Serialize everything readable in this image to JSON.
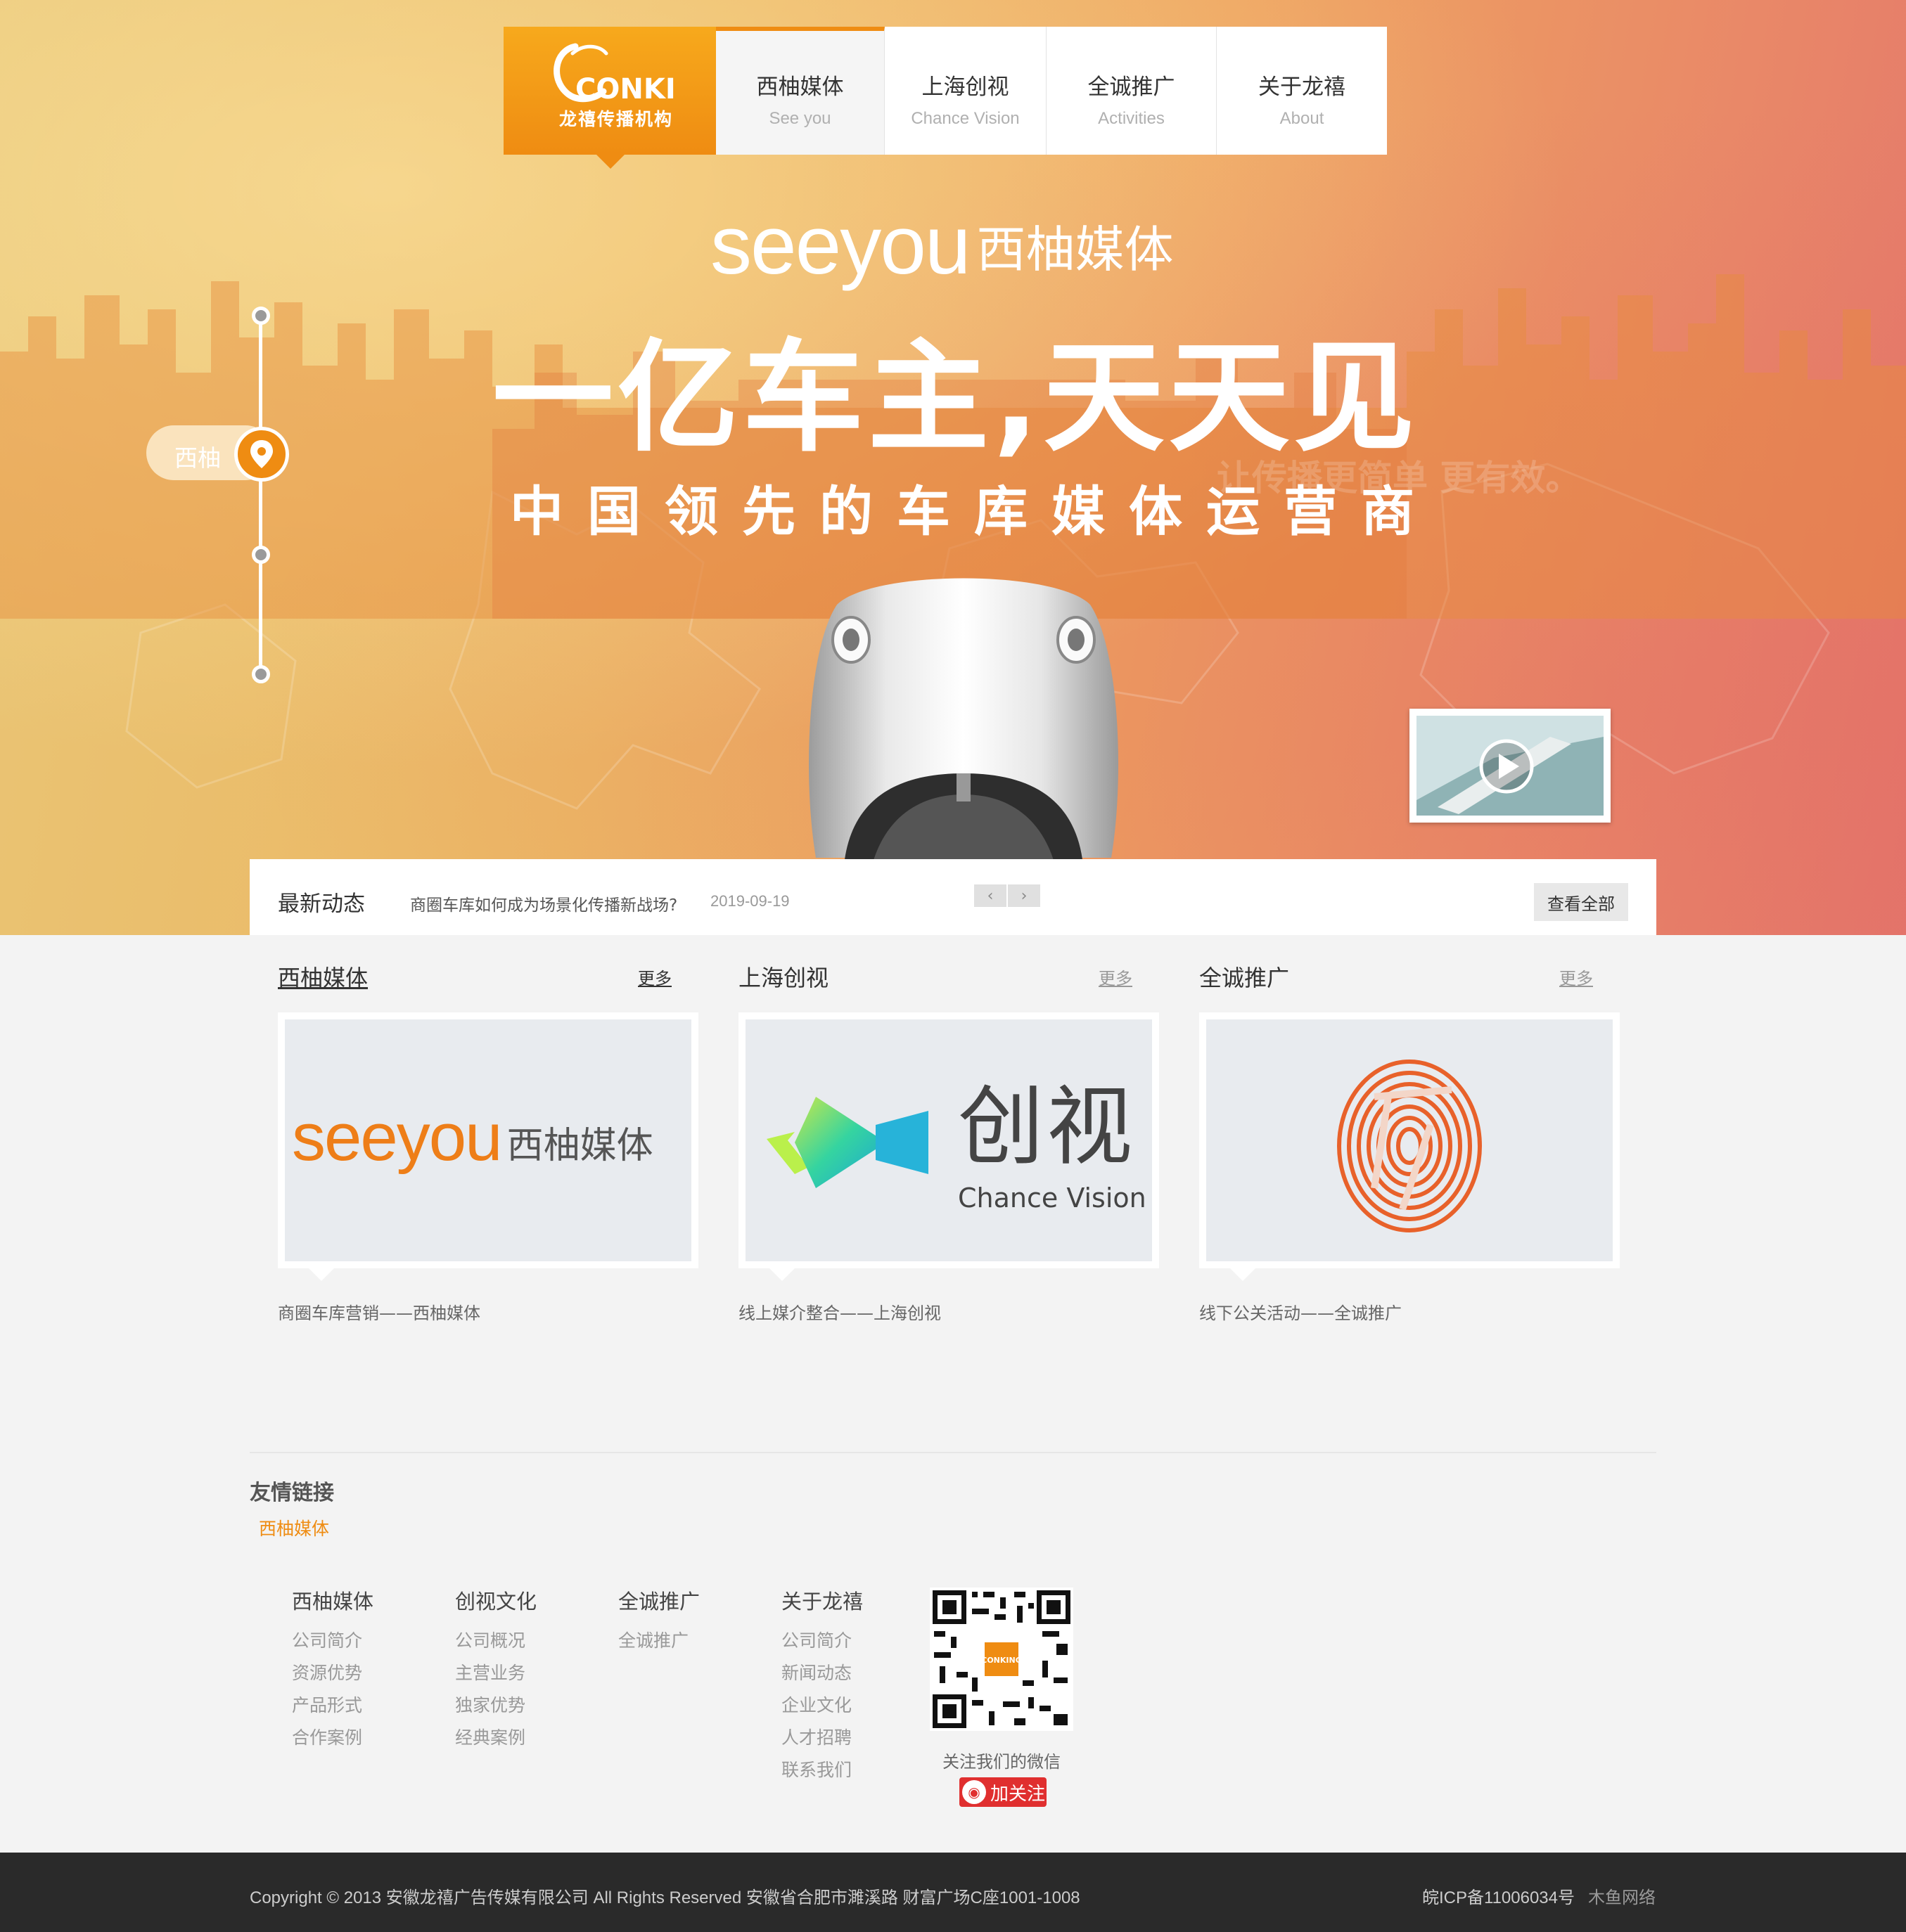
{
  "colors": {
    "accent": "#ef8c12",
    "dark_bar": "#2a2a2a",
    "weibo_red": "#e02f2f"
  },
  "logo": {
    "brand_en": "CONKING",
    "brand_cn": "龙禧传播机构"
  },
  "nav": [
    {
      "cn": "西柚媒体",
      "en": "See you"
    },
    {
      "cn": "上海创视",
      "en": "Chance Vision"
    },
    {
      "cn": "全诚推广",
      "en": "Activities"
    },
    {
      "cn": "关于龙禧",
      "en": "About"
    }
  ],
  "hero": {
    "brand_en": "seeyou",
    "brand_cn": "西柚媒体",
    "slogan": "一亿车主,天天见",
    "subslogan": "中国领先的车库媒体运营商",
    "ghost": "让传播更简单 更有效。",
    "timeline_label": "西柚",
    "play_icon": "play-icon"
  },
  "news": {
    "title": "最新动态",
    "item": "商圈车库如何成为场景化传播新战场?",
    "date": "2019-09-19",
    "prev": "‹",
    "next": "›",
    "view_all": "查看全部"
  },
  "columns": [
    {
      "title": "西柚媒体",
      "more": "更多",
      "caption": "商圈车库营销——西柚媒体",
      "logo_en": "seeyou",
      "logo_cn": "西柚媒体"
    },
    {
      "title": "上海创视",
      "more": "更多",
      "caption": "线上媒介整合——上海创视",
      "logo_cn": "创视",
      "logo_en": "Chance Vision"
    },
    {
      "title": "全诚推广",
      "more": "更多",
      "caption": "线下公关活动——全诚推广"
    }
  ],
  "links": {
    "title": "友情链接",
    "items": [
      "西柚媒体"
    ]
  },
  "footer_menu": [
    {
      "title": "西柚媒体",
      "items": [
        "公司简介",
        "资源优势",
        "产品形式",
        "合作案例"
      ]
    },
    {
      "title": "创视文化",
      "items": [
        "公司概况",
        "主营业务",
        "独家优势",
        "经典案例"
      ]
    },
    {
      "title": "全诚推广",
      "items": [
        "全诚推广"
      ]
    },
    {
      "title": "关于龙禧",
      "items": [
        "公司简介",
        "新闻动态",
        "企业文化",
        "人才招聘",
        "联系我们"
      ]
    }
  ],
  "wechat": {
    "label": "关注我们的微信"
  },
  "weibo": {
    "label": "加关注"
  },
  "bottom": {
    "copyright": "Copyright © 2013 安徽龙禧广告传媒有限公司  All Rights Reserved  安徽省合肥市濉溪路  财富广场C座1001-1008",
    "icp": "皖ICP备11006034号",
    "maker": "木鱼网络"
  }
}
